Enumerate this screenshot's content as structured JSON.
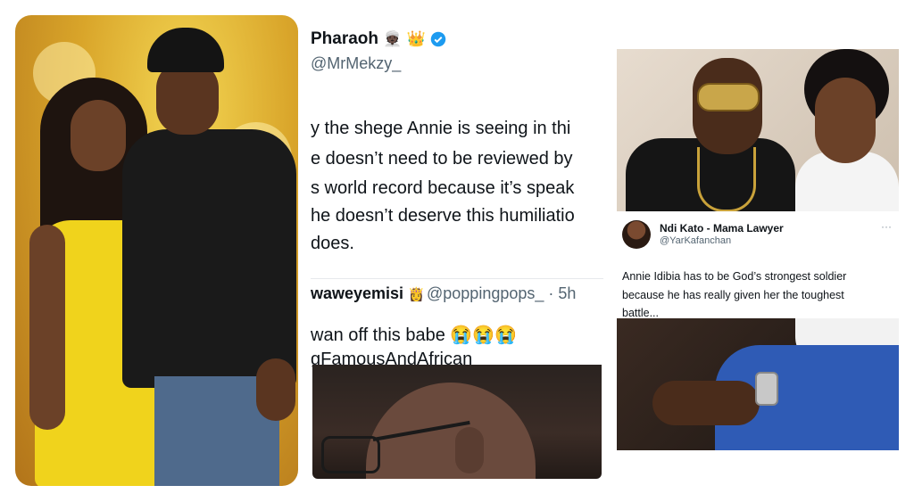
{
  "panel_left": {
    "image": "couple-photo"
  },
  "panel_middle": {
    "tweet": {
      "name": "Pharaoh",
      "handle": "@MrMekzy_",
      "lines": [
        "y the shege Annie is seeing in thi",
        "e doesn’t need to be reviewed by",
        "s world record because it’s speak",
        "he doesn’t deserve this humiliatio",
        "does."
      ]
    },
    "quoted": {
      "name": "waweyemisi",
      "handle": "@poppingpops_",
      "time": "· 5h",
      "lines": [
        "wan off this babe 😭😭😭",
        "gFamousAndAfrican"
      ]
    }
  },
  "panel_right": {
    "tweet": {
      "name": "Ndi Kato - Mama Lawyer",
      "handle": "@YarKafanchan",
      "more": "···",
      "lines": [
        "Annie Idibia has to be God’s strongest soldier",
        "because he has really given her the toughest",
        "battle..."
      ]
    }
  },
  "colors": {
    "verified": "#1d9bf0",
    "text": "#0f1419",
    "muted": "#536471"
  }
}
